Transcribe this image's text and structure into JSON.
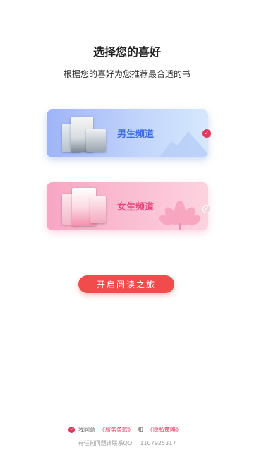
{
  "header": {
    "title": "选择您的喜好",
    "subtitle": "根据您的喜好为您推荐最合适的书"
  },
  "channels": [
    {
      "label": "男生频道",
      "selected": true
    },
    {
      "label": "女生频道",
      "selected": false
    }
  ],
  "start_button": "开启阅读之旅",
  "footer": {
    "agree_prefix": "我同意",
    "terms_link": "《服务条款》",
    "and": "和",
    "privacy_link": "《隐私策略》",
    "contact_label": "有任何问题请联系QQ:",
    "contact_qq": "1107925317"
  },
  "colors": {
    "accent": "#e8355a",
    "button": "#f24b4b",
    "male_text": "#3b6be0",
    "female_text": "#e8467a"
  }
}
